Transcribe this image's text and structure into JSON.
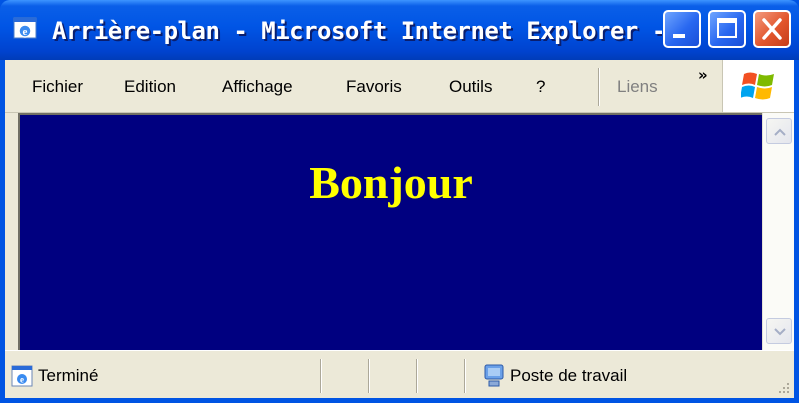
{
  "window": {
    "title": "Arrière-plan - Microsoft Internet Explorer - [T...",
    "title_bar_color": "#0054e3"
  },
  "titlebar_buttons": {
    "minimize_icon": "minimize-icon",
    "maximize_icon": "maximize-icon",
    "close_icon": "close-icon"
  },
  "menubar": {
    "items": [
      {
        "label": "Fichier"
      },
      {
        "label": "Edition"
      },
      {
        "label": "Affichage"
      },
      {
        "label": "Favoris"
      },
      {
        "label": "Outils"
      },
      {
        "label": "?"
      }
    ],
    "links_label": "Liens",
    "overflow_chevron": "»"
  },
  "content": {
    "background_color": "#000080",
    "heading": "Bonjour",
    "heading_color": "#ffff00"
  },
  "statusbar": {
    "status_text": "Terminé",
    "zone_text": "Poste de travail"
  }
}
